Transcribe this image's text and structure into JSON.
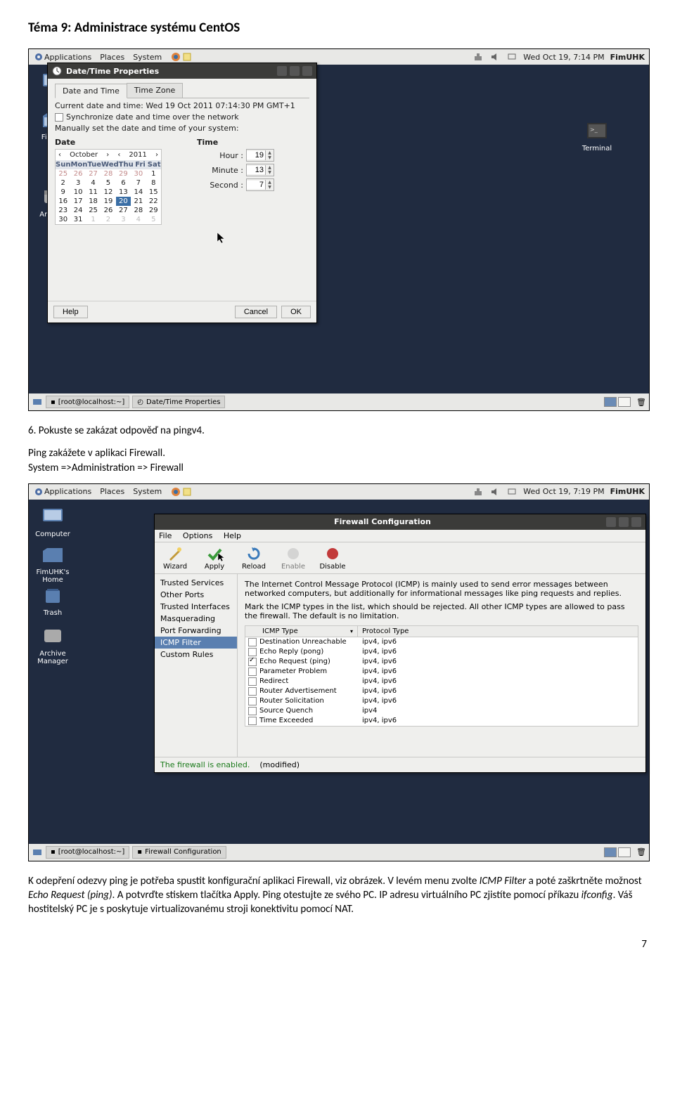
{
  "doc": {
    "title": "Téma 9: Administrace systému CentOS",
    "step6": "6. Pokuste se zakázat odpověď na pingv4.",
    "p1a": "Ping zakážete v aplikaci Firewall.",
    "p1b": "System =>Administration => Firewall",
    "p2": "K odepření odezvy ping je potřeba spustit konfigurační aplikaci Firewall, viz obrázek. V levém menu zvolte ICMP Filter a poté zaškrtněte možnost Echo Request (ping). A potvrďte stiskem tlačítka Apply. Ping otestujte ze svého PC. IP adresu virtuálního PC zjistíte pomocí příkazu ifconfig. Váš hostitelský PC je s poskytuje virtualizovanému stroji konektivitu pomocí NAT.",
    "page": "7"
  },
  "panel": {
    "menus": [
      "Applications",
      "Places",
      "System"
    ],
    "clock1": "Wed Oct 19,  7:14 PM",
    "clock2": "Wed Oct 19,  7:19 PM",
    "user": "FimUHK"
  },
  "desktop": {
    "icons": [
      {
        "label": "Computer"
      },
      {
        "label": "FimUHK's Home"
      },
      {
        "label": "Trash"
      },
      {
        "label": "Archive Manager"
      }
    ],
    "terminal": "Terminal"
  },
  "taskbar1": {
    "task1": "[root@localhost:~]",
    "task2": "Date/Time Properties"
  },
  "taskbar2": {
    "task1": "[root@localhost:~]",
    "task2": "Firewall Configuration"
  },
  "datetime": {
    "title": "Date/Time Properties",
    "tabs": [
      "Date and Time",
      "Time Zone"
    ],
    "current": "Current date and time:  Wed 19 Oct 2011 07:14:30 PM GMT+1",
    "sync": "Synchronize date and time over the network",
    "manual": "Manually set the date and time of your system:",
    "date_lbl": "Date",
    "time_lbl": "Time",
    "month": "October",
    "year": "2011",
    "dow": [
      "Sun",
      "Mon",
      "Tue",
      "Wed",
      "Thu",
      "Fri",
      "Sat"
    ],
    "hour_lbl": "Hour :",
    "hour": "19",
    "min_lbl": "Minute :",
    "min": "13",
    "sec_lbl": "Second :",
    "sec": "7",
    "help": "Help",
    "cancel": "Cancel",
    "ok": "OK"
  },
  "firewall": {
    "title": "Firewall Configuration",
    "menu": [
      "File",
      "Options",
      "Help"
    ],
    "toolbar": [
      {
        "label": "Wizard"
      },
      {
        "label": "Apply"
      },
      {
        "label": "Reload"
      },
      {
        "label": "Enable"
      },
      {
        "label": "Disable"
      }
    ],
    "side": [
      "Trusted Services",
      "Other Ports",
      "Trusted Interfaces",
      "Masquerading",
      "Port Forwarding",
      "ICMP Filter",
      "Custom Rules"
    ],
    "side_sel": 5,
    "desc1": "The Internet Control Message Protocol (ICMP) is mainly used to send error messages between networked computers, but additionally for informational messages like ping requests and replies.",
    "desc2": "Mark the ICMP types in the list, which should be rejected. All other ICMP types are allowed to pass the firewall. The default is no limitation.",
    "th1": "ICMP Type",
    "th2": "Protocol Type",
    "rows": [
      {
        "name": "Destination Unreachable",
        "proto": "ipv4, ipv6",
        "chk": false
      },
      {
        "name": "Echo Reply (pong)",
        "proto": "ipv4, ipv6",
        "chk": false
      },
      {
        "name": "Echo Request (ping)",
        "proto": "ipv4, ipv6",
        "chk": true
      },
      {
        "name": "Parameter Problem",
        "proto": "ipv4, ipv6",
        "chk": false
      },
      {
        "name": "Redirect",
        "proto": "ipv4, ipv6",
        "chk": false
      },
      {
        "name": "Router Advertisement",
        "proto": "ipv4, ipv6",
        "chk": false
      },
      {
        "name": "Router Solicitation",
        "proto": "ipv4, ipv6",
        "chk": false
      },
      {
        "name": "Source Quench",
        "proto": "ipv4",
        "chk": false
      },
      {
        "name": "Time Exceeded",
        "proto": "ipv4, ipv6",
        "chk": false
      }
    ],
    "status_en": "The firewall is enabled.",
    "status_mod": "(modified)"
  }
}
